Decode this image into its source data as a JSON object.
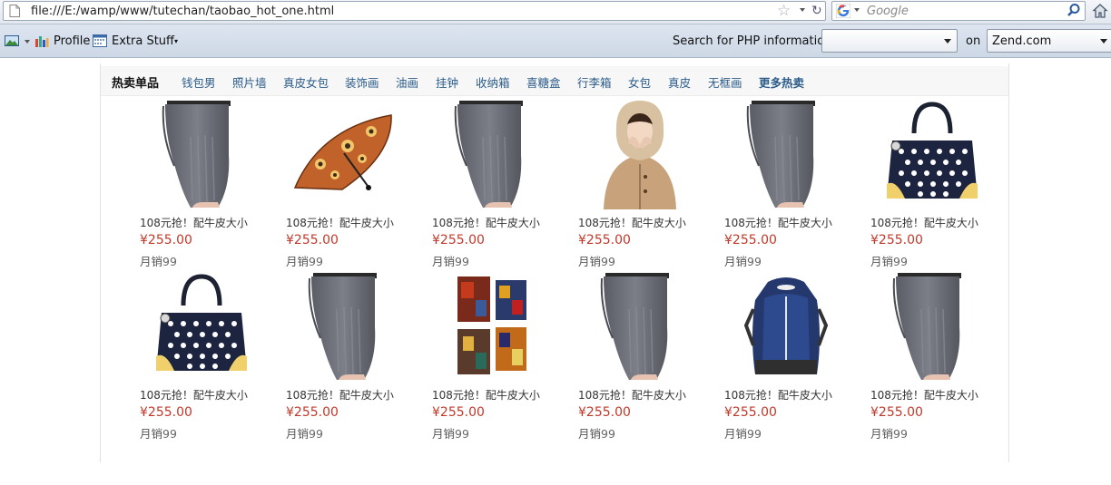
{
  "browser": {
    "url": "file:///E:/wamp/www/tutechan/taobao_hot_one.html",
    "search_placeholder": "Google"
  },
  "toolbar": {
    "profile_label": "Profile",
    "extra_label": "Extra Stuff",
    "php_search_label": "Search for PHP information:",
    "php_search_value": "",
    "on_label": "on",
    "site_select_value": "Zend.com"
  },
  "tabs": [
    "热卖单品",
    "钱包男",
    "照片墙",
    "真皮女包",
    "装饰画",
    "油画",
    "挂钟",
    "收纳箱",
    "喜糖盒",
    "行李箱",
    "女包",
    "真皮",
    "无框画",
    "更多热卖"
  ],
  "products": [
    {
      "title": "108元抢！配牛皮大小",
      "price": "¥255.00",
      "sales_label": "月销",
      "sales": "99",
      "image": "knee-pads"
    },
    {
      "title": "108元抢！配牛皮大小",
      "price": "¥255.00",
      "sales_label": "月销",
      "sales": "99",
      "image": "umbrella"
    },
    {
      "title": "108元抢！配牛皮大小",
      "price": "¥255.00",
      "sales_label": "月销",
      "sales": "99",
      "image": "knee-pads"
    },
    {
      "title": "108元抢！配牛皮大小",
      "price": "¥255.00",
      "sales_label": "月销",
      "sales": "99",
      "image": "woman-coat"
    },
    {
      "title": "108元抢！配牛皮大小",
      "price": "¥255.00",
      "sales_label": "月销",
      "sales": "99",
      "image": "knee-pads"
    },
    {
      "title": "108元抢！配牛皮大小",
      "price": "¥255.00",
      "sales_label": "月销",
      "sales": "99",
      "image": "polka-bag"
    },
    {
      "title": "108元抢！配牛皮大小",
      "price": "¥255.00",
      "sales_label": "月销",
      "sales": "99",
      "image": "polka-bag"
    },
    {
      "title": "108元抢！配牛皮大小",
      "price": "¥255.00",
      "sales_label": "月销",
      "sales": "99",
      "image": "knee-pads"
    },
    {
      "title": "108元抢！配牛皮大小",
      "price": "¥255.00",
      "sales_label": "月销",
      "sales": "99",
      "image": "wall-paintings"
    },
    {
      "title": "108元抢！配牛皮大小",
      "price": "¥255.00",
      "sales_label": "月销",
      "sales": "99",
      "image": "knee-pads"
    },
    {
      "title": "108元抢！配牛皮大小",
      "price": "¥255.00",
      "sales_label": "月销",
      "sales": "99",
      "image": "backpack"
    },
    {
      "title": "108元抢！配牛皮大小",
      "price": "¥255.00",
      "sales_label": "月销",
      "sales": "99",
      "image": "knee-pads"
    }
  ],
  "colors": {
    "price": "#c0392b",
    "tab_link": "#2b5c8a"
  }
}
